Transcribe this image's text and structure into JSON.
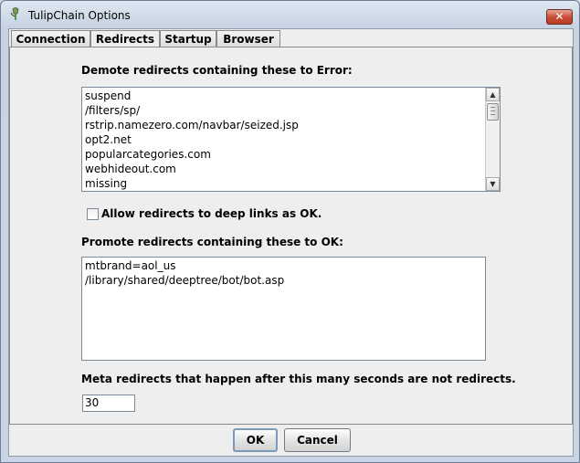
{
  "window": {
    "title": "TulipChain Options",
    "close_glyph": "✕",
    "app_icon": "tulip-icon"
  },
  "tabs": [
    {
      "label": "Connection",
      "active": false
    },
    {
      "label": "Redirects",
      "active": true
    },
    {
      "label": "Startup",
      "active": false
    },
    {
      "label": "Browser",
      "active": false
    }
  ],
  "redirects": {
    "demote_label": "Demote redirects containing these to Error:",
    "demote_items": [
      "suspend",
      "/filters/sp/",
      "rstrip.namezero.com/navbar/seized.jsp",
      "opt2.net",
      "popularcategories.com",
      "webhideout.com",
      "missing"
    ],
    "deep_links_label": "Allow redirects to deep links as OK.",
    "deep_links_checked": false,
    "promote_label": "Promote redirects containing these to OK:",
    "promote_items": [
      "mtbrand=aol_us",
      "/library/shared/deeptree/bot/bot.asp"
    ],
    "meta_label": "Meta redirects that happen after this many seconds are not redirects.",
    "meta_seconds": "30"
  },
  "buttons": {
    "ok": "OK",
    "cancel": "Cancel"
  },
  "colors": {
    "accent_border": "#7b9ab8",
    "close_red": "#c9503a"
  }
}
